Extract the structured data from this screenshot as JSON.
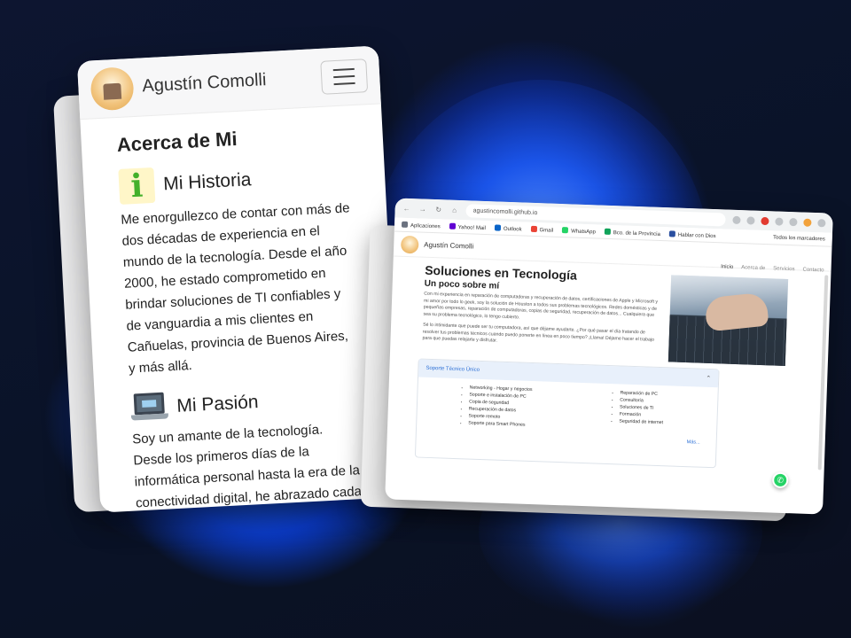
{
  "mobile": {
    "brand": "Agustín Comolli",
    "heading": "Acerca de Mi",
    "sections": [
      {
        "title": "Mi Historia",
        "icon": "info-icon",
        "text": "Me enorgullezco de contar con más de dos décadas de experiencia en el mundo de la tecnología. Desde el año 2000, he estado comprometido en brindar soluciones de TI confiables y de vanguardia a mis clientes en Cañuelas, provincia de Buenos Aires, y más allá."
      },
      {
        "title": "Mi Pasión",
        "icon": "laptop-icon",
        "text": "Soy un amante de la tecnología. Desde los primeros días de la informática personal hasta la era de la conectividad digital, he abrazado cada"
      }
    ]
  },
  "desktop": {
    "url": "agustincomolli.github.io",
    "bookmarks": [
      "Aplicaciones",
      "Yahoo! Mail",
      "Outlook",
      "Gmail",
      "WhatsApp",
      "Bco. de la Provincia",
      "Hablar con Dios"
    ],
    "all_bookmarks": "Todos los marcadores",
    "brand": "Agustín Comolli",
    "nav_links": [
      "Inicio",
      "Acerca de",
      "Servicios",
      "Contacto"
    ],
    "title": "Soluciones en Tecnología",
    "subtitle": "Un poco sobre mí",
    "para1": "Con mi experiencia en reparación de computadoras y recuperación de datos, certificaciones de Apple y Microsoft y mi amor por todo lo geek, soy la solución de Houston a todos sus problemas tecnológicos. Redes domésticas y de pequeñas empresas, reparación de computadoras, copias de seguridad, recuperación de datos... Cualquiera que sea su problema tecnológico, lo tengo cubierto.",
    "para2": "Sé lo intimidante que puede ser tu computadora, así que déjame ayudarte. ¿Por qué pasar el día tratando de resolver tus problemas técnicos cuando puedo ponerte en línea en poco tiempo? ¡Llama! Déjame hacer el trabajo para que puedas relajarte y disfrutar.",
    "accordion_title": "Soporte Técnico Único",
    "list_a": [
      "Networking - Hogar y negocios",
      "Soporte e instalación de PC",
      "Copia de seguridad",
      "Recuperación de datos",
      "Soporte remoto",
      "Soporte para Smart Phones"
    ],
    "list_b": [
      "Reparación de PC",
      "Consultoría",
      "Soluciones de TI",
      "Formación",
      "Seguridad de internet"
    ],
    "more": "Más..."
  },
  "colors": {
    "accent_blue": "#2b6fd6",
    "whatsapp": "#25d366",
    "info_green": "#43b02a"
  }
}
